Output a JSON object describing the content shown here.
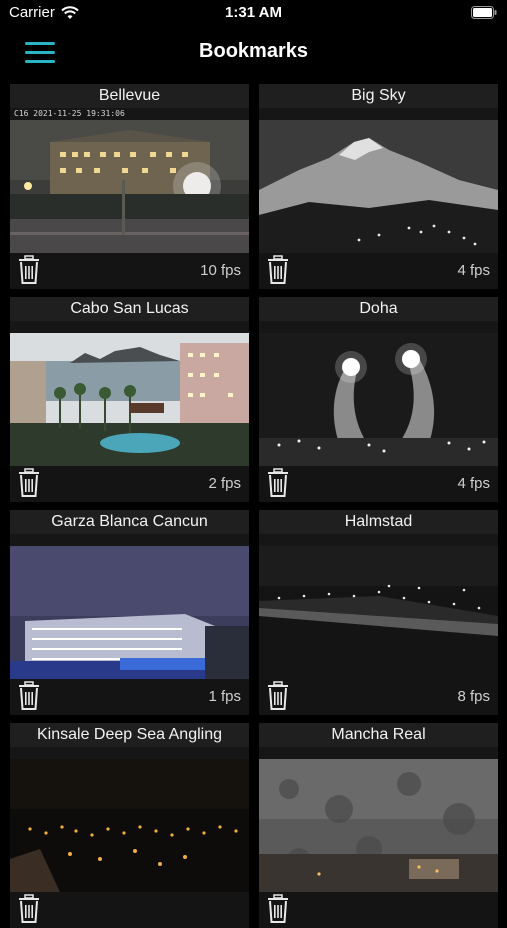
{
  "status_bar": {
    "carrier": "Carrier",
    "time": "1:31 AM",
    "icons": [
      "wifi-icon",
      "battery-icon"
    ]
  },
  "nav": {
    "title": "Bookmarks",
    "menu_icon": "hamburger-menu-icon",
    "accent_color": "#2bb3c8"
  },
  "bookmarks": [
    {
      "name": "Bellevue",
      "fps": "10 fps",
      "stamp": "C16 2021-11-25 19:31:06"
    },
    {
      "name": "Big Sky",
      "fps": "4 fps",
      "stamp": ""
    },
    {
      "name": "Cabo San Lucas",
      "fps": "2 fps",
      "stamp": ""
    },
    {
      "name": "Doha",
      "fps": "4 fps",
      "stamp": ""
    },
    {
      "name": "Garza Blanca Cancun",
      "fps": "1 fps",
      "stamp": ""
    },
    {
      "name": "Halmstad",
      "fps": "8 fps",
      "stamp": ""
    },
    {
      "name": "Kinsale Deep Sea Angling",
      "fps": "",
      "stamp": ""
    },
    {
      "name": "Mancha Real",
      "fps": "",
      "stamp": ""
    }
  ]
}
